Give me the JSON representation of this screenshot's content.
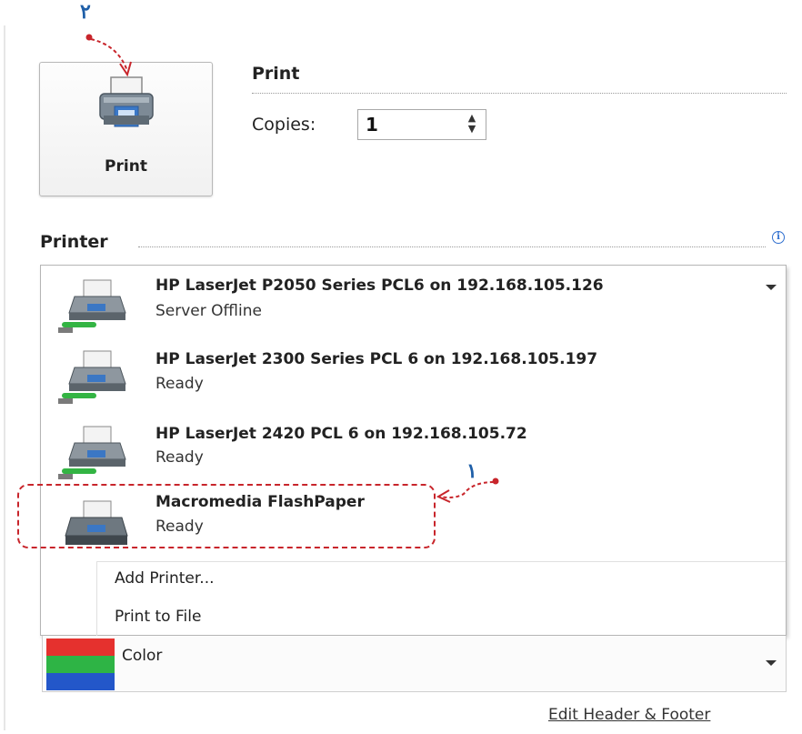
{
  "annotations": {
    "num_top": "٢",
    "num_bottom": "١"
  },
  "print": {
    "button_label": "Print",
    "section_title": "Print",
    "copies_label": "Copies:",
    "copies_value": "1"
  },
  "printer": {
    "section_title": "Printer",
    "info_icon": "i",
    "items": [
      {
        "name": "HP LaserJet P2050 Series PCL6 on 192.168.105.126",
        "status": "Server Offline",
        "icon": "network-printer-icon"
      },
      {
        "name": "HP LaserJet 2300 Series PCL 6 on 192.168.105.197",
        "status": "Ready",
        "icon": "network-printer-icon"
      },
      {
        "name": "HP LaserJet 2420 PCL 6 on 192.168.105.72",
        "status": "Ready",
        "icon": "network-printer-icon"
      },
      {
        "name": "Macromedia FlashPaper",
        "status": "Ready",
        "icon": "printer-icon"
      }
    ],
    "menu": {
      "add_printer": "Add Printer...",
      "print_to_file": "Print to File"
    }
  },
  "color_setting": {
    "label": "Color"
  },
  "footer": {
    "edit_header_footer": "Edit Header & Footer"
  },
  "colors": {
    "annotation_red": "#c8252b",
    "annotation_blue": "#1f5fa8"
  }
}
